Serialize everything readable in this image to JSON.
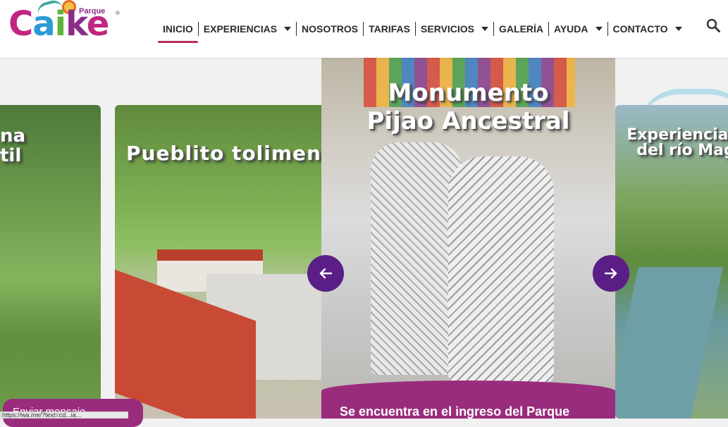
{
  "header": {
    "logo_small": "Parque",
    "logo_word": [
      "C",
      "a",
      "i",
      "k",
      "e"
    ],
    "logo_reg": "®"
  },
  "nav": {
    "items": [
      {
        "label": "INICIO",
        "active": true,
        "dropdown": false
      },
      {
        "label": "EXPERIENCIAS",
        "active": false,
        "dropdown": true
      },
      {
        "label": "NOSOTROS",
        "active": false,
        "dropdown": false
      },
      {
        "label": "TARIFAS",
        "active": false,
        "dropdown": false
      },
      {
        "label": "SERVICIOS",
        "active": false,
        "dropdown": true
      },
      {
        "label": "GALERÍA",
        "active": false,
        "dropdown": false
      },
      {
        "label": "AYUDA",
        "active": false,
        "dropdown": true
      },
      {
        "label": "CONTACTO",
        "active": false,
        "dropdown": true
      }
    ],
    "search_icon": "search-icon",
    "active_color": "#b8305f"
  },
  "carousel": {
    "slides": [
      {
        "title": "na\ntil"
      },
      {
        "title": "Pueblito tolimense"
      },
      {
        "title": "Monumento\nPijao Ancestral",
        "caption": "Se encuentra en el ingreso del Parque"
      },
      {
        "title": "Experiencia n\ndel río Mag"
      }
    ],
    "prev_icon": "arrow-left-icon",
    "next_icon": "arrow-right-icon",
    "accent": "#5a1e86",
    "caption_color": "#9a2c7e"
  },
  "message_button": {
    "label": "Enviar mensaje"
  },
  "status_bar": {
    "url": "https://wa.me/?text=cd...ia..."
  }
}
